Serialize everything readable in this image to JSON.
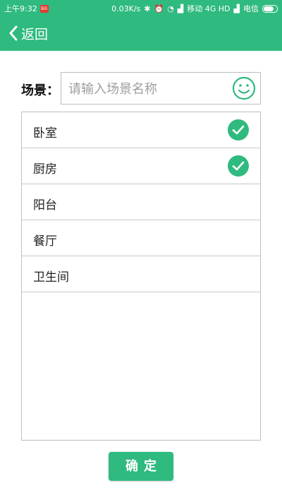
{
  "status_bar": {
    "time": "上午9:32",
    "notification_badge": "Bili",
    "network_speed": "0.03K/s",
    "carrier1": "移动 4G HD",
    "carrier2": "电信"
  },
  "header": {
    "back_label": "返回",
    "background_color": "#2fba7f"
  },
  "scene": {
    "label": "场景：",
    "placeholder": "请输入场景名称",
    "value": ""
  },
  "rooms": [
    {
      "label": "卧室",
      "checked": true
    },
    {
      "label": "厨房",
      "checked": true
    },
    {
      "label": "阳台",
      "checked": false
    },
    {
      "label": "餐厅",
      "checked": false
    },
    {
      "label": "卫生间",
      "checked": false
    }
  ],
  "confirm_label": "确定",
  "icons": {
    "back": "chevron-left-icon",
    "emoji": "smile-icon",
    "check": "check-circle-icon"
  },
  "accent_color": "#2fba7f"
}
